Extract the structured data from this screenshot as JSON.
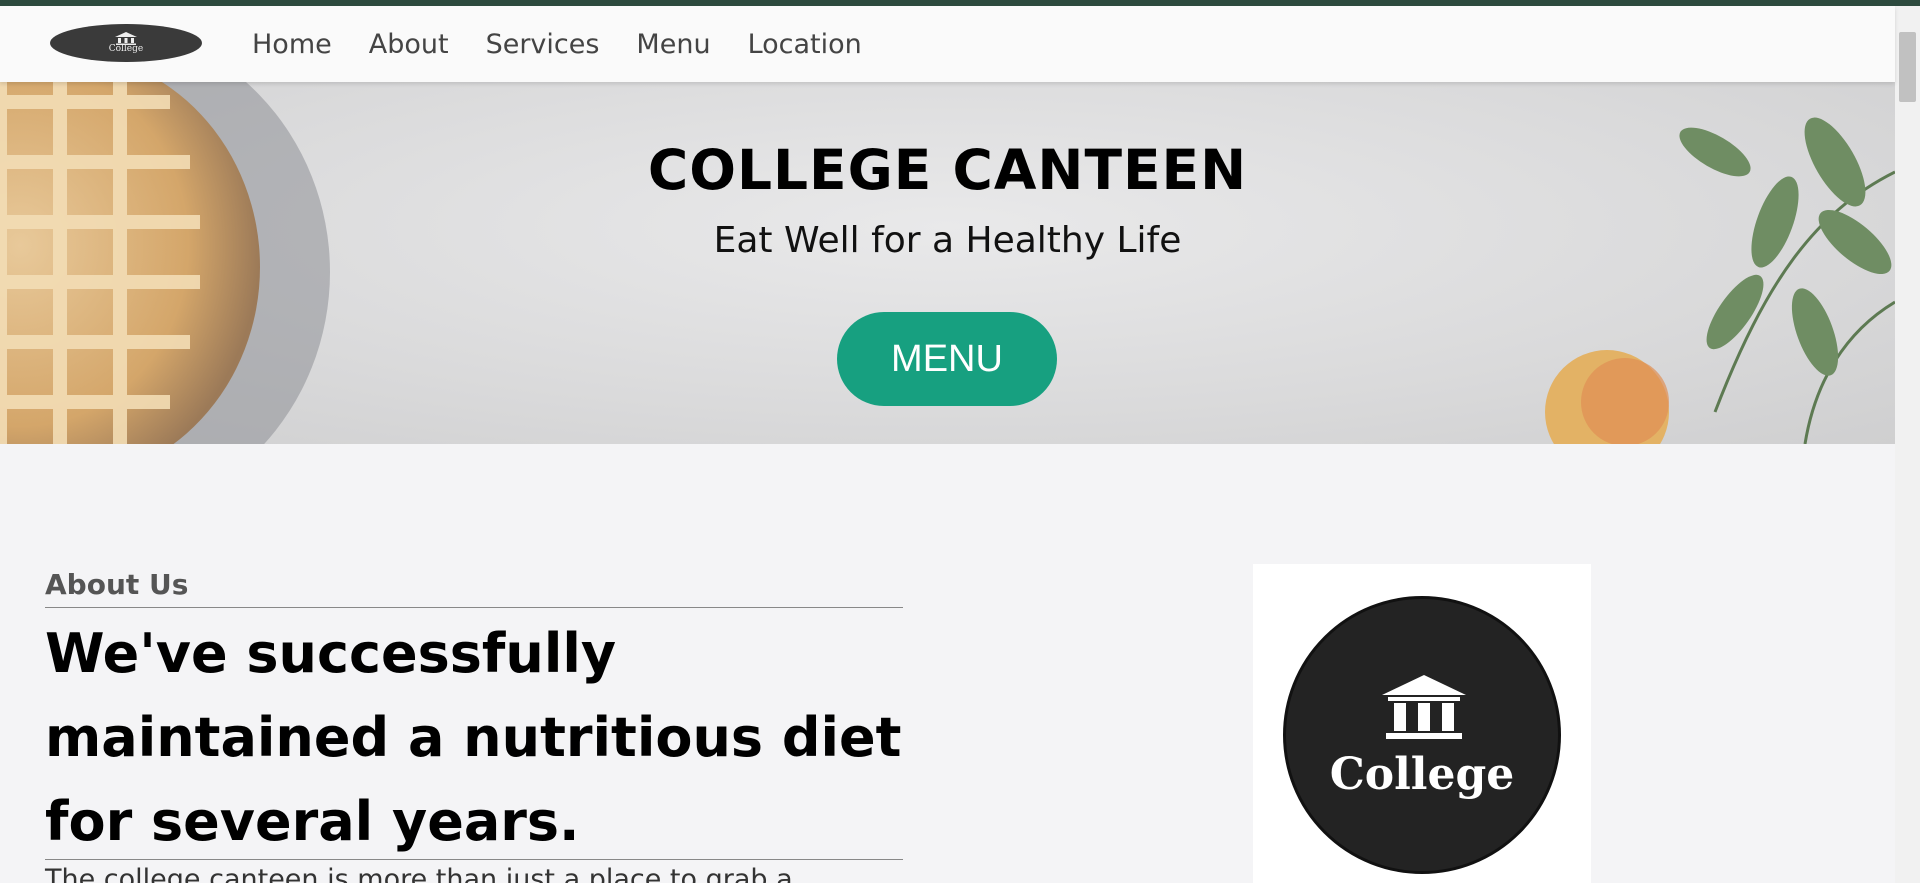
{
  "nav": {
    "logo_text": "College",
    "links": [
      "Home",
      "About",
      "Services",
      "Menu",
      "Location"
    ]
  },
  "hero": {
    "title": "COLLEGE CANTEEN",
    "subtitle": "Eat Well for a Healthy Life",
    "button_label": "MENU"
  },
  "about": {
    "label": "About Us",
    "heading": "We've successfully maintained a nutritious diet for several years.",
    "text": "The college canteen is more than just a place to grab a",
    "logo_text": "College"
  },
  "colors": {
    "accent": "#17a080",
    "top_border": "#2d4a3e",
    "logo_dark": "#232323"
  }
}
